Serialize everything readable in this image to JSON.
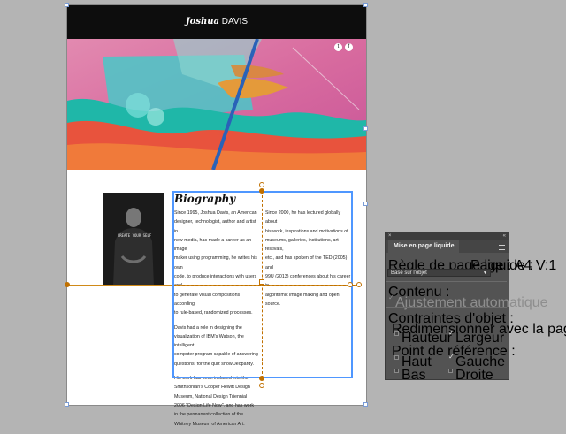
{
  "page": {
    "header_first": "Joshua",
    "header_last": "DAVIS",
    "social": {
      "twitter": "t",
      "facebook": "f"
    },
    "photo_shirt_text": "CREATE YOUR SELF",
    "bio": {
      "title": "Biography",
      "col1_p1": [
        "Since 1995, Joshua Davis, an American",
        "designer, technologist, author and artist in",
        "new media, has made a career as an image",
        "maker using programming, he writes his own",
        "code, to produce interactions with users and",
        "to generate visual compositions according",
        "to rule-based, randomized processes."
      ],
      "col1_p2": [
        "Davis had a role in designing the",
        "visualization of IBM's Watson, the intelligent",
        "computer program capable of answering",
        "questions, for the quiz show Jeopardy."
      ],
      "col1_p3": [
        "His work has been included into the",
        "Smithsonian's Cooper Hewitt Design",
        "Museum, National Design Triennial",
        "2006 \"Design Life Now\", and has work",
        "in the permanent collection of the",
        "Whitney Museum of American Art."
      ],
      "col2_p1": [
        "Since 2000, he has lectured globally about",
        "his work, inspirations and motivations of",
        "museums, galleries, institutions, art festivals,",
        "etc., and has spoken of the TED (2005) and",
        "99U (2013) conferences about his career in",
        "algorithmic image making and open source."
      ]
    }
  },
  "panel": {
    "close": "×",
    "collapse": "«",
    "tab": "Mise en page liquide",
    "rule_label": "Règle de page liquide :",
    "page_info": "Page : A4 V:1",
    "rule_value": "Basé sur l'objet",
    "content_heading": "Contenu :",
    "auto_fit": "Ajustement automatique",
    "constraints_heading": "Contraintes d'objet :",
    "resize_heading": "Redimensionner avec la page :",
    "height": "Hauteur",
    "width": "Largeur",
    "ref_heading": "Point de référence :",
    "top": "Haut",
    "left": "Gauche",
    "bottom": "Bas",
    "right": "Droite"
  }
}
